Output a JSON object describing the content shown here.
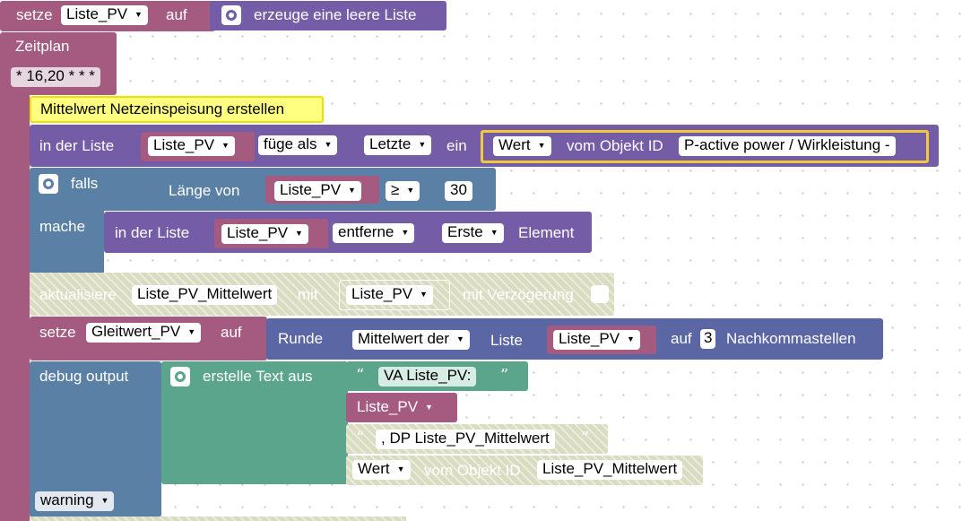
{
  "blocks": {
    "set_list": {
      "keyword": "setze",
      "variable": "Liste_PV",
      "to": "auf",
      "value": "erzeuge eine leere Liste"
    },
    "schedule": {
      "label": "Zeitplan",
      "cron": "* 16,20 * * *"
    },
    "comment": "Mittelwert Netzeinspeisung erstellen",
    "list_add": {
      "in_list": "in der Liste",
      "variable": "Liste_PV",
      "mode": "füge als",
      "position": "Letzte",
      "as": "ein",
      "value_field": "Wert",
      "of_object": "vom Objekt ID",
      "object_id": "P-active power / Wirkleistung -"
    },
    "if": {
      "falls": "falls",
      "length_of": "Länge von",
      "variable": "Liste_PV",
      "operator": "≥",
      "number": "30",
      "do": "mache"
    },
    "list_remove": {
      "in_list": "in der Liste",
      "variable": "Liste_PV",
      "mode": "entferne",
      "position": "Erste",
      "element": "Element"
    },
    "update": {
      "label": "aktualisiere",
      "target": "Liste_PV_Mittelwert",
      "with": "mit",
      "variable": "Liste_PV",
      "delay": "mit Verzögerung"
    },
    "set_avg": {
      "keyword": "setze",
      "variable": "Gleitwert_PV",
      "to": "auf",
      "round": "Runde",
      "mean": "Mittelwert der",
      "list": "Liste",
      "list_var": "Liste_PV",
      "on": "auf",
      "digits": "3",
      "decimals": "Nachkommastellen"
    },
    "debug": {
      "label": "debug output",
      "create_text": "erstelle Text aus",
      "text1": "VA Liste_PV:",
      "var": "Liste_PV",
      "text2": ", DP Liste_PV_Mittelwert",
      "value_field": "Wert",
      "of_object": "vom Objekt ID",
      "object_id": "Liste_PV_Mittelwert",
      "level": "warning"
    }
  },
  "colors": {
    "variable": "#a55b80",
    "list": "#745ca6",
    "logic": "#5b80a5",
    "text": "#5ba58c",
    "io": "#5b67a5",
    "comment": "#ffff80",
    "disabled": "#d9dcc0"
  }
}
